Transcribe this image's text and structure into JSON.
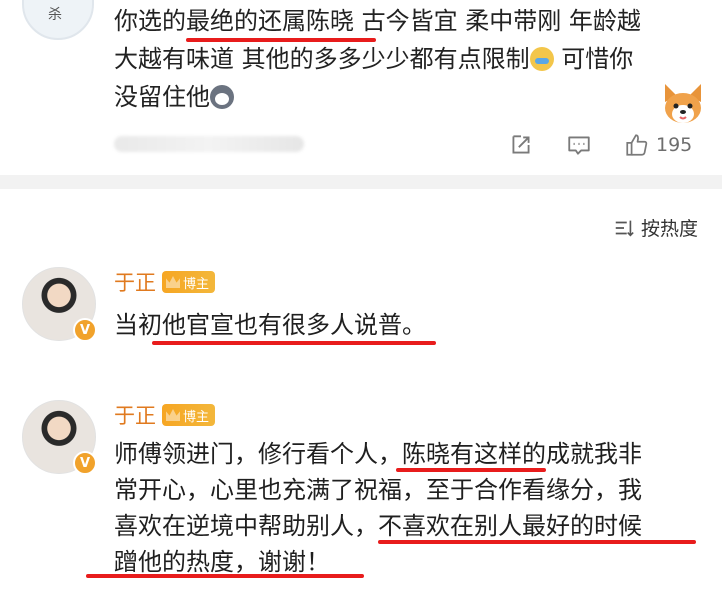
{
  "prev_comment": {
    "lines": [
      [
        "你选的",
        "最绝的还属陈晓",
        " 古今皆宜 柔中带刚 年龄越"
      ],
      [
        "大越有味道 其他的多多少少都有点限制",
        "[cry]",
        " 可惜你"
      ],
      [
        "没留住他",
        "[husky]"
      ]
    ],
    "line1_a": "你选的",
    "line1_b": "最绝的还属陈晓",
    "line1_c": " 古今皆宜 柔中带刚 年龄越",
    "line2_a": "大越有味道 其他的多多少少都有点限制",
    "line2_c": " 可惜你",
    "line3_a": "没留住他",
    "avatar_glyph": "杀",
    "like_count": "195",
    "emoji_1": "crying-emoji",
    "emoji_2": "husky-emoji",
    "sticker": "corgi-sticker"
  },
  "sort": {
    "label": "按热度"
  },
  "comments": [
    {
      "name": "于正",
      "badge": "博主",
      "text_line1": "当初他官宣也有很多人说普。"
    },
    {
      "name": "于正",
      "badge": "博主",
      "line1_a": "师傅领进门，修行看个人，",
      "line1_b": "陈晓有这样",
      "line1_c": "的成就我非",
      "line2": "常开心，心里也充满了祝福，至于合作看缘分，我",
      "line3_a": "喜欢在逆境中帮助别人，",
      "line3_b": "不喜欢在别人最好的时候",
      "line4": "蹭他的热度，谢谢！"
    }
  ],
  "colors": {
    "underline": "#e81c1c",
    "name": "#e07a1f",
    "badge": "#f6a623",
    "divider": "#f2f2f2"
  },
  "icons": {
    "share": "share-icon",
    "comment": "comment-icon",
    "like": "thumbs-up-icon",
    "sort": "sort-icon",
    "verified": "verified-v-icon",
    "crown": "crown-icon"
  }
}
